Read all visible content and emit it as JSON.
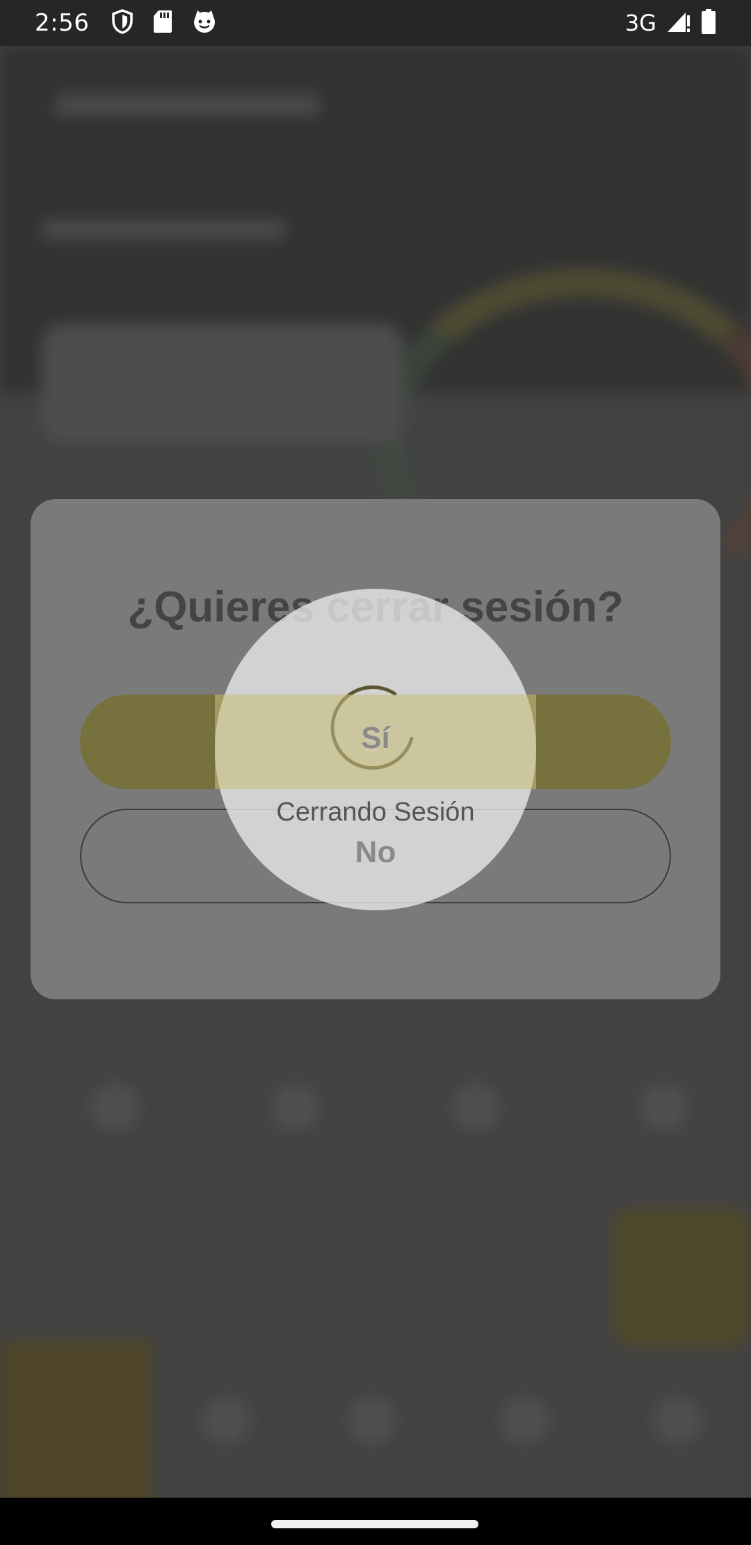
{
  "status_bar": {
    "time": "2:56",
    "network": "3G",
    "icons_left": [
      "shield-icon",
      "sd-card-icon",
      "cat-face-icon"
    ],
    "icons_right": [
      "signal-icon",
      "battery-icon"
    ]
  },
  "dialog": {
    "title": "¿Quieres cerrar sesión?",
    "confirm_label": "Sí",
    "cancel_label": "No"
  },
  "loading": {
    "message": "Cerrando Sesión"
  },
  "colors": {
    "dialog_bg": "#7a7a7a",
    "confirm_bg": "#77713e",
    "title_text": "#444444",
    "status_bar_bg": "#262626",
    "nav_bar_bg": "#000000"
  }
}
